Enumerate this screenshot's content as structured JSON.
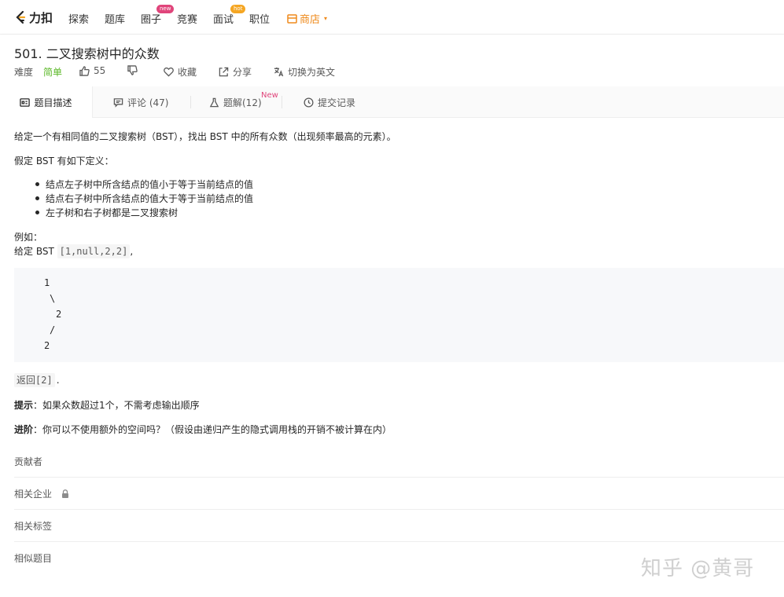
{
  "nav": {
    "logo_text": "力扣",
    "items": [
      {
        "label": "探索"
      },
      {
        "label": "题库"
      },
      {
        "label": "圈子",
        "badge": "new"
      },
      {
        "label": "竞赛"
      },
      {
        "label": "面试",
        "badge": "hot"
      },
      {
        "label": "职位"
      }
    ],
    "store_label": "商店",
    "accent": "#ef8a1b"
  },
  "problem": {
    "title": "501. 二叉搜索树中的众数",
    "difficulty_label": "难度",
    "difficulty_value": "简单",
    "likes": "55",
    "favorite_label": "收藏",
    "share_label": "分享",
    "translate_label": "切换为英文"
  },
  "tabs": [
    {
      "label": "题目描述",
      "icon": "description-icon",
      "active": true
    },
    {
      "label": "评论 (47)",
      "icon": "comment-icon"
    },
    {
      "label": "题解(12)",
      "icon": "flask-icon",
      "badge": "New"
    },
    {
      "label": "提交记录",
      "icon": "clock-icon"
    }
  ],
  "description": {
    "intro": "给定一个有相同值的二叉搜索树（BST），找出 BST 中的所有众数（出现频率最高的元素）。",
    "definition_intro": "假定 BST 有如下定义：",
    "bullets": [
      "结点左子树中所含结点的值小于等于当前结点的值",
      "结点右子树中所含结点的值大于等于当前结点的值",
      "左子树和右子树都是二叉搜索树"
    ],
    "example_label": "例如：",
    "example_given_prefix": "给定 BST ",
    "example_given_code": "[1,null,2,2]",
    "example_given_suffix": ",",
    "tree_lines": [
      "1",
      "\\",
      "2",
      "/",
      "2"
    ],
    "return_code": "返回[2]",
    "return_suffix": ".",
    "hint_label": "提示",
    "hint_text": "：如果众数超过1个，不需考虑输出顺序",
    "advanced_label": "进阶",
    "advanced_text": "：你可以不使用额外的空间吗？（假设由递归产生的隐式调用栈的开销不被计算在内）"
  },
  "sections": [
    "贡献者",
    "相关企业",
    "相关标签",
    "相似题目"
  ],
  "watermark": "知乎 @黄哥"
}
